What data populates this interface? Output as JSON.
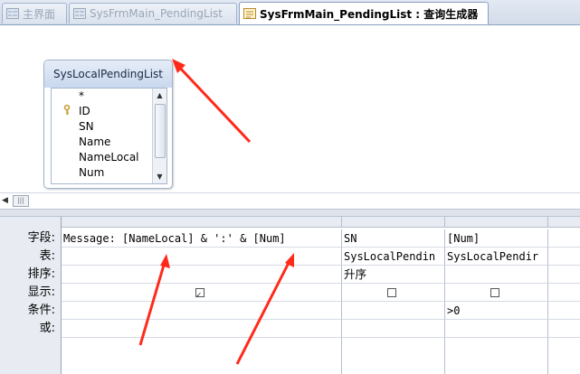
{
  "tabs": [
    {
      "label": "主界面",
      "active": false
    },
    {
      "label": "SysFrmMain_PendingList",
      "active": false
    },
    {
      "label": "SysFrmMain_PendingList : 查询生成器",
      "active": true
    }
  ],
  "table_box": {
    "title": "SysLocalPendingList",
    "fields": [
      "*",
      "ID",
      "SN",
      "Name",
      "NameLocal",
      "Num"
    ],
    "primary_key_field": "ID"
  },
  "grid": {
    "row_labels": [
      "字段:",
      "表:",
      "排序:",
      "显示:",
      "条件:",
      "或:"
    ],
    "columns": [
      {
        "field": "Message: [NameLocal] & ':' & [Num]",
        "table": "",
        "sort": "",
        "show": true,
        "criteria": ""
      },
      {
        "field": "SN",
        "table": "SysLocalPendin",
        "sort": "升序",
        "show": false,
        "criteria": ""
      },
      {
        "field": "[Num]",
        "table": "SysLocalPendir",
        "sort": "",
        "show": false,
        "criteria": ">0"
      }
    ]
  },
  "annotation_color": "#ff2a1a"
}
